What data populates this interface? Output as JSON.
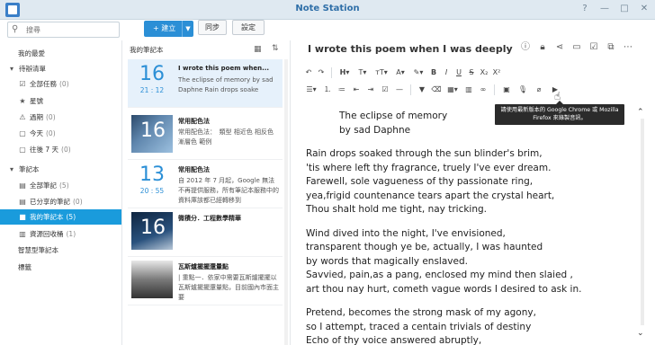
{
  "window": {
    "title": "Note Station",
    "controls": [
      "?",
      "—",
      "□",
      "✕"
    ]
  },
  "search": {
    "placeholder": "搜尋"
  },
  "toolbar": {
    "new_label": "+ 建立",
    "sync_label": "同步",
    "settings_label": "設定"
  },
  "sidebar": {
    "items": [
      {
        "label": "我的最愛",
        "count": "",
        "icon": "",
        "indent": 0
      },
      {
        "label": "待辦清單",
        "count": "",
        "icon": "caret-down-icon",
        "glyph": "▾",
        "indent": 0
      },
      {
        "label": "全部任務",
        "count": "(0)",
        "icon": "checkbox-icon",
        "glyph": "☑",
        "indent": 1
      },
      {
        "label": "星號",
        "count": "",
        "icon": "star-icon",
        "glyph": "★",
        "indent": 1
      },
      {
        "label": "過期",
        "count": "(0)",
        "icon": "warning-icon",
        "glyph": "⚠",
        "indent": 1
      },
      {
        "label": "今天",
        "count": "(0)",
        "icon": "calendar-icon",
        "glyph": "▢",
        "indent": 1
      },
      {
        "label": "往後 7 天",
        "count": "(0)",
        "icon": "calendar-week-icon",
        "glyph": "▢",
        "indent": 1
      },
      {
        "label": "筆記本",
        "count": "",
        "icon": "caret-down-icon",
        "glyph": "▾",
        "indent": 0
      },
      {
        "label": "全部筆記",
        "count": "(5)",
        "icon": "notes-icon",
        "glyph": "▤",
        "indent": 1
      },
      {
        "label": "已分享的筆記",
        "count": "(0)",
        "icon": "shared-notes-icon",
        "glyph": "▤",
        "indent": 1
      },
      {
        "label": "我的筆記本",
        "count": "(5)",
        "icon": "notebook-icon",
        "glyph": "■",
        "indent": 1,
        "active": true
      },
      {
        "label": "資源回收桶",
        "count": "(1)",
        "icon": "trash-icon",
        "glyph": "▥",
        "indent": 1
      },
      {
        "label": "智慧型筆記本",
        "count": "",
        "icon": "",
        "indent": 0
      },
      {
        "label": "標籤",
        "count": "",
        "icon": "",
        "indent": 0
      }
    ]
  },
  "list": {
    "header": "我的筆記本",
    "notes": [
      {
        "type": "date",
        "day": "16",
        "time": "21 : 12",
        "title": "I wrote this poem when...",
        "snippet": "The eclipse of memory by sad Daphne Rain drops soake"
      },
      {
        "type": "thumb",
        "day": "16",
        "title": "常用配色法",
        "snippet": "常用配色法：　類型 相近色 相反色 漸層色 範例"
      },
      {
        "type": "date",
        "day": "13",
        "time": "20 : 55",
        "title": "常用配色法",
        "snippet": "自 2012 年 7 月起，Google 無法不再提供服務，所有筆記本服務中的資料庫該都已經轉移到"
      },
      {
        "type": "thumb",
        "day": "16",
        "title": "微積分．工程數學精華",
        "snippet": ""
      },
      {
        "type": "thumb",
        "day": "",
        "title": "瓦斯爐擺擺還量點",
        "snippet": "| 重點一．依家中需要瓦斯爐擺擺以瓦斯爐擺擺還量點，目前國內市面主要"
      }
    ]
  },
  "editor": {
    "title": "I wrote this poem when I was deeply dc",
    "tooltip": "請使用最新版本的 Google Chrome 或 Mozilla Firefox 來錄製音訊。",
    "heading_lines": [
      "The eclipse of memory",
      "by sad Daphne"
    ],
    "stanzas": [
      [
        "Rain drops soaked through the sun blinder's brim,",
        "'tis where left thy fragrance, truely I've ever dream.",
        "Farewell, sole vagueness of thy passionate ring,",
        "yea,frigid countenance tears apart the crystal heart,",
        "Thou shalt hold me tight, nay tricking."
      ],
      [
        "Wind dived into the night, I've envisioned,",
        "transparent though ye be, actually, I was haunted",
        "by words that magically enslaved.",
        "Savvied, pain,as a pang, enclosed my mind then slaied ,",
        "art thou nay hurt, cometh vague words I desired to ask in."
      ],
      [
        "Pretend, becomes the strong mask of my agony,",
        "so I attempt, traced a centain trivials of destiny",
        "Echo of thy voice answered abruptly,"
      ]
    ]
  },
  "colors": {
    "accent": "#1a9bdc",
    "title_blue": "#2f6fa8",
    "date_blue": "#2b8fd6"
  }
}
